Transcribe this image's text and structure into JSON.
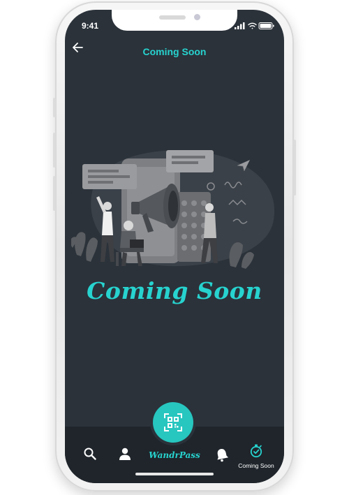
{
  "status_bar": {
    "time": "9:41"
  },
  "header": {
    "title": "Coming Soon",
    "back_icon": "back-arrow-icon"
  },
  "main": {
    "illustration": "megaphone-announcement-illustration",
    "headline": "Coming Soon"
  },
  "bottom_nav": {
    "items": [
      {
        "icon": "search-icon"
      },
      {
        "icon": "user-icon"
      },
      {
        "label": "WandrPass",
        "icon": "qr-code-icon"
      },
      {
        "icon": "bell-icon"
      },
      {
        "label": "Coming Soon",
        "icon": "stopwatch-icon"
      }
    ]
  },
  "colors": {
    "accent": "#27d3cf",
    "screen_bg": "#2b323a",
    "nav_bg": "#1f252b"
  }
}
